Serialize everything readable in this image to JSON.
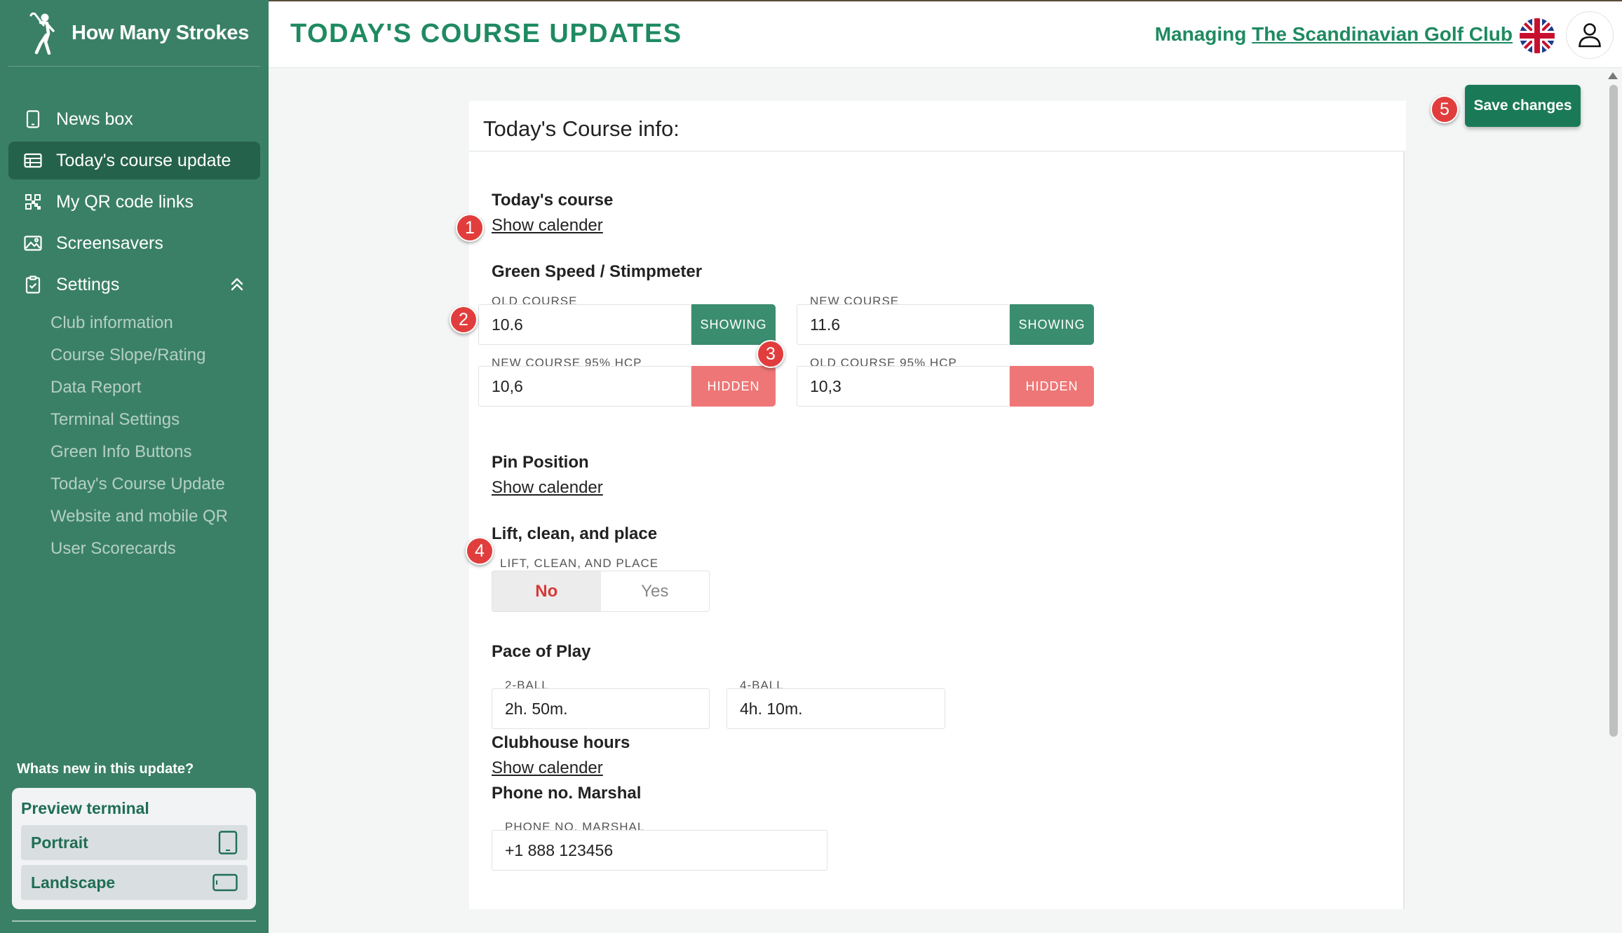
{
  "brand": {
    "name": "How Many Strokes"
  },
  "nav": {
    "items": [
      {
        "label": "News box",
        "icon": "tablet-icon"
      },
      {
        "label": "Today's course update",
        "icon": "table-icon"
      },
      {
        "label": "My QR code links",
        "icon": "qr-code-icon"
      },
      {
        "label": "Screensavers",
        "icon": "image-icon"
      },
      {
        "label": "Settings",
        "icon": "clipboard-icon"
      }
    ],
    "settings_sub": [
      "Club information",
      "Course Slope/Rating",
      "Data Report",
      "Terminal Settings",
      "Green Info Buttons",
      "Today's Course Update",
      "Website and mobile QR",
      "User Scorecards"
    ]
  },
  "sidebar_footer": {
    "whats_new": "Whats new in this update?",
    "preview_title": "Preview terminal",
    "portrait": "Portrait",
    "landscape": "Landscape"
  },
  "header": {
    "title": "TODAY'S COURSE UPDATES",
    "managing_prefix": "Managing",
    "club_name": "The Scandinavian Golf Club"
  },
  "actions": {
    "save": "Save changes"
  },
  "card": {
    "title": "Today's Course info:",
    "todays_course": {
      "label": "Today's course",
      "link": "Show calender"
    },
    "green_speed": {
      "label": "Green Speed / Stimpmeter",
      "fields": [
        {
          "label": "OLD COURSE",
          "value": "10.6",
          "state": "SHOWING"
        },
        {
          "label": "NEW COURSE",
          "value": "11.6",
          "state": "SHOWING"
        },
        {
          "label": "NEW COURSE 95% HCP",
          "value": "10,6",
          "state": "HIDDEN"
        },
        {
          "label": "OLD COURSE 95% HCP",
          "value": "10,3",
          "state": "HIDDEN"
        }
      ]
    },
    "pin_position": {
      "label": "Pin Position",
      "link": "Show calender"
    },
    "lift_clean_place": {
      "label": "Lift, clean, and place",
      "field_label": "LIFT, CLEAN, AND PLACE",
      "options": [
        "No",
        "Yes"
      ],
      "selected": "No"
    },
    "pace_of_play": {
      "label": "Pace of Play",
      "two_ball": {
        "label": "2-BALL",
        "value": "2h. 50m."
      },
      "four_ball": {
        "label": "4-BALL",
        "value": "4h. 10m."
      }
    },
    "clubhouse_hours": {
      "label": "Clubhouse hours",
      "link": "Show calender"
    },
    "phone_marshal": {
      "label": "Phone no. Marshal",
      "field_label": "PHONE NO. MARSHAL",
      "value": "+1 888 123456"
    }
  },
  "markers": [
    "1",
    "2",
    "3",
    "4",
    "5"
  ],
  "colors": {
    "sidebar": "#3a8067",
    "accent": "#1f8a61",
    "showing": "#3b8d6f",
    "hidden": "#ef7676",
    "save": "#1a7a58"
  }
}
